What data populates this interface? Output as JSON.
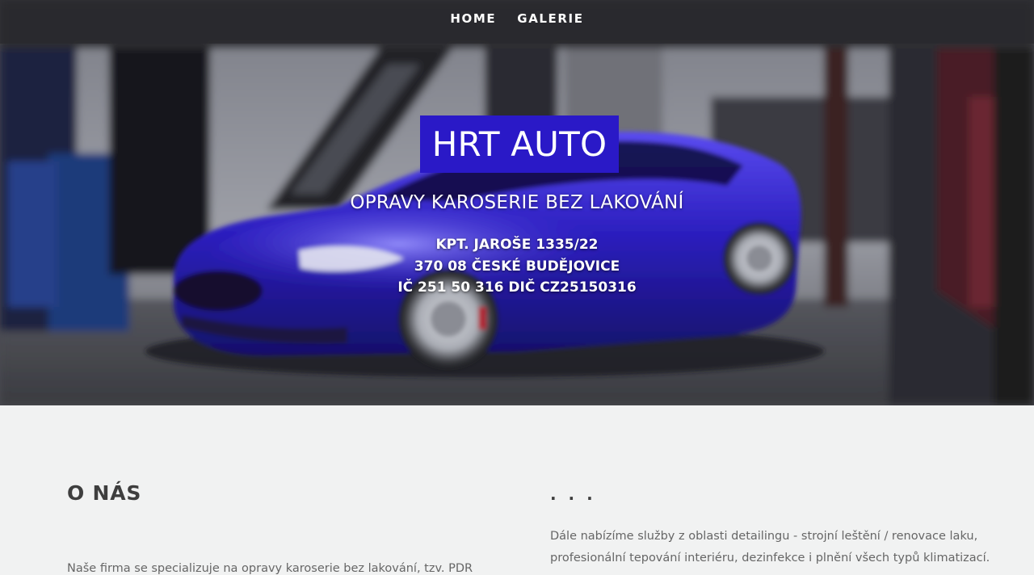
{
  "nav": {
    "items": [
      {
        "label": "HOME"
      },
      {
        "label": "GALERIE"
      }
    ]
  },
  "hero": {
    "background": "blurred garage photo with blue sports car",
    "brand": "HRT AUTO",
    "brand_color": "#2a19c7",
    "tagline": "OPRAVY KAROSERIE BEZ LAKOVÁNÍ",
    "address": {
      "street": "KPT. JAROŠE 1335/22",
      "city": "370 08 ČESKÉ BUDĚJOVICE",
      "ids": "IČ 251 50 316 DIČ CZ25150316"
    }
  },
  "about": {
    "title": "O NÁS",
    "paragraph_start": "Naše firma se specializuje na opravy karoserie bez lakování, tzv. PDR"
  },
  "more": {
    "title": ". . .",
    "lines": [
      "Dále nabízíme služby z oblasti detailingu - strojní leštění / renovace laku,",
      "profesionální tepování interiéru, dezinfekce i plnění všech typů klimatizací."
    ]
  }
}
